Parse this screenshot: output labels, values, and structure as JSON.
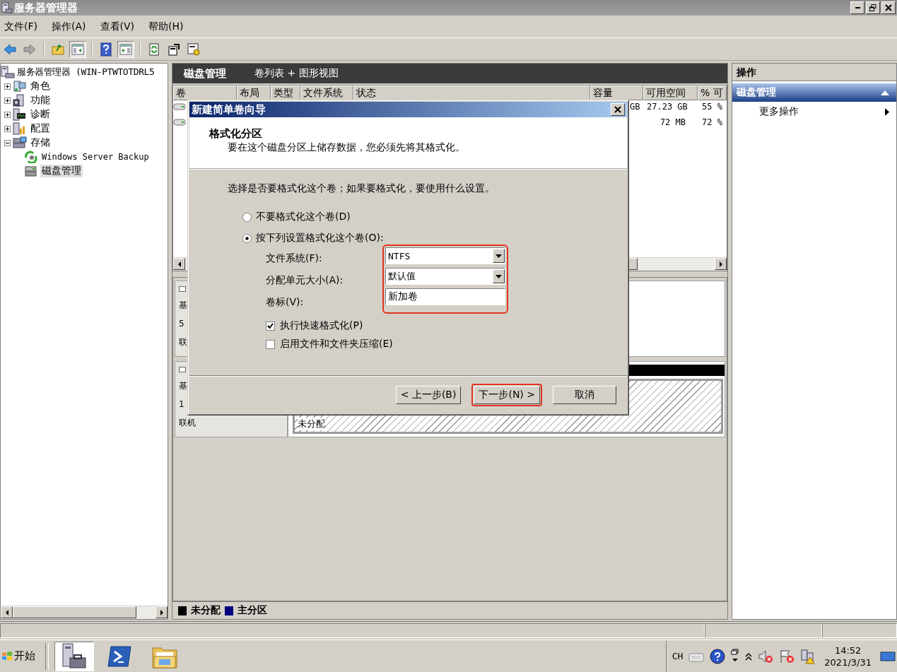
{
  "window": {
    "title": "服务器管理器"
  },
  "menu": [
    "文件(F)",
    "操作(A)",
    "查看(V)",
    "帮助(H)"
  ],
  "tree": {
    "label": "服务器管理器 (WIN-PTWTOTDRL5",
    "children": [
      {
        "label": "角色",
        "expanded": false,
        "selected": false
      },
      {
        "label": "功能",
        "expanded": false,
        "selected": false
      },
      {
        "label": "诊断",
        "expanded": false,
        "selected": false
      },
      {
        "label": "配置",
        "expanded": false,
        "selected": false
      },
      {
        "label": "存储",
        "expanded": true,
        "selected": false,
        "children": [
          {
            "label": "Windows Server Backup",
            "selected": false
          },
          {
            "label": "磁盘管理",
            "selected": true
          }
        ]
      }
    ]
  },
  "center": {
    "title": "磁盘管理",
    "view": "卷列表 + 图形视图",
    "columns": [
      "卷",
      "布局",
      "类型",
      "文件系统",
      "状态",
      "容量",
      "可用空间",
      "% 可"
    ],
    "rows": [
      {
        "capacity": "GB",
        "free": "27.23 GB",
        "percent": "55 %"
      },
      {
        "capacity": "",
        "free": "72 MB",
        "percent": "72 %"
      }
    ],
    "disks": [
      {
        "lines": [
          "基",
          "5",
          "联"
        ]
      },
      {
        "lines": [
          "基",
          "1",
          "联机"
        ],
        "partition": "未分配"
      }
    ],
    "legend": [
      {
        "label": "未分配",
        "color": "#000000"
      },
      {
        "label": "主分区",
        "color": "#000080"
      }
    ]
  },
  "actions": {
    "title": "操作",
    "section": "磁盘管理",
    "expanded": true,
    "items": [
      "更多操作"
    ]
  },
  "dialog": {
    "title": "新建简单卷向导",
    "heading": "格式化分区",
    "subheading": "要在这个磁盘分区上储存数据，您必须先将其格式化。",
    "prompt": "选择是否要格式化这个卷；如果要格式化，要使用什么设置。",
    "options": [
      {
        "label": "不要格式化这个卷(D)",
        "selected": false
      },
      {
        "label": "按下列设置格式化这个卷(O):",
        "selected": true
      }
    ],
    "fields_highlighted": true,
    "fields": [
      {
        "label": "文件系统(F):",
        "kind": "dropdown",
        "value": "NTFS"
      },
      {
        "label": "分配单元大小(A):",
        "kind": "dropdown",
        "value": "默认值"
      },
      {
        "label": "卷标(V):",
        "kind": "text",
        "value": "新加卷"
      }
    ],
    "checkboxes": [
      {
        "label": "执行快速格式化(P)",
        "checked": true
      },
      {
        "label": "启用文件和文件夹压缩(E)",
        "checked": false
      }
    ],
    "buttons": [
      {
        "label": "< 上一步(B)",
        "highlighted": false
      },
      {
        "label": "下一步(N) >",
        "highlighted": true
      },
      {
        "label": "取消",
        "highlighted": false
      }
    ]
  },
  "taskbar": {
    "start": "开始",
    "language": "CH",
    "time": "14:52",
    "date": "2021/3/31"
  }
}
